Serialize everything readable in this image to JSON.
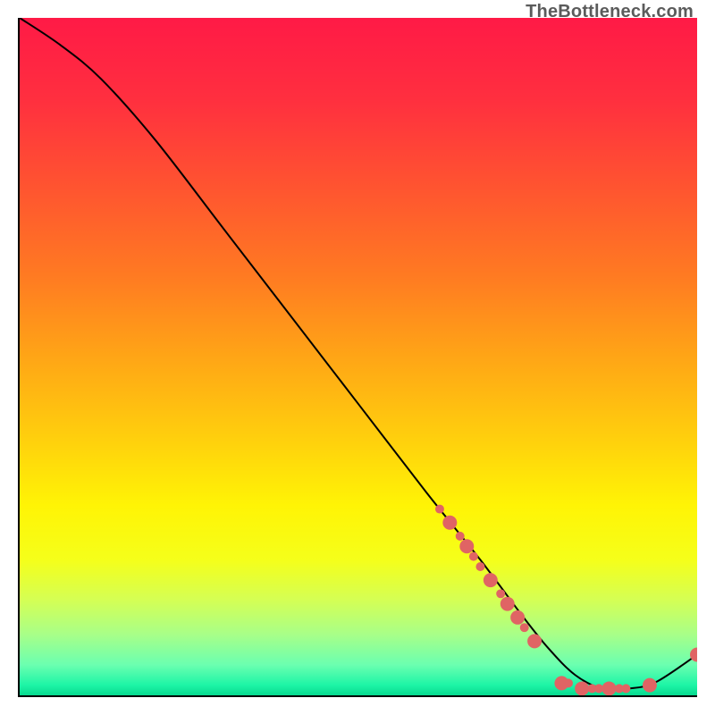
{
  "watermark": "TheBottleneck.com",
  "gradient_stops": [
    {
      "offset": 0.0,
      "color": "#ff1a46"
    },
    {
      "offset": 0.12,
      "color": "#ff2f3f"
    },
    {
      "offset": 0.25,
      "color": "#ff5430"
    },
    {
      "offset": 0.38,
      "color": "#ff7a22"
    },
    {
      "offset": 0.5,
      "color": "#ffa516"
    },
    {
      "offset": 0.62,
      "color": "#ffcf0d"
    },
    {
      "offset": 0.72,
      "color": "#fff405"
    },
    {
      "offset": 0.8,
      "color": "#f5ff1a"
    },
    {
      "offset": 0.86,
      "color": "#d4ff55"
    },
    {
      "offset": 0.91,
      "color": "#a8ff88"
    },
    {
      "offset": 0.955,
      "color": "#6bffb0"
    },
    {
      "offset": 0.985,
      "color": "#1df5a6"
    },
    {
      "offset": 1.0,
      "color": "#07d98f"
    }
  ],
  "chart_data": {
    "type": "line",
    "title": "",
    "xlabel": "",
    "ylabel": "",
    "xlim": [
      0,
      100
    ],
    "ylim": [
      0,
      100
    ],
    "series": [
      {
        "name": "bottleneck-curve",
        "x": [
          0,
          6,
          12,
          20,
          30,
          40,
          50,
          60,
          68,
          74,
          78,
          82,
          86,
          90,
          94,
          100
        ],
        "y": [
          100,
          96,
          91,
          82,
          69,
          56,
          43,
          30,
          20,
          12,
          7,
          3,
          1,
          1,
          2,
          6
        ]
      }
    ],
    "scatter": {
      "name": "sample-points",
      "color": "#e06464",
      "radius_small": 5,
      "radius_large": 8,
      "points": [
        {
          "x": 62.0,
          "y": 27.5,
          "r": "s"
        },
        {
          "x": 63.5,
          "y": 25.5,
          "r": "l"
        },
        {
          "x": 65.0,
          "y": 23.5,
          "r": "s"
        },
        {
          "x": 66.0,
          "y": 22.0,
          "r": "l"
        },
        {
          "x": 67.0,
          "y": 20.5,
          "r": "s"
        },
        {
          "x": 68.0,
          "y": 19.0,
          "r": "s"
        },
        {
          "x": 69.5,
          "y": 17.0,
          "r": "l"
        },
        {
          "x": 71.0,
          "y": 15.0,
          "r": "s"
        },
        {
          "x": 72.0,
          "y": 13.5,
          "r": "l"
        },
        {
          "x": 73.5,
          "y": 11.5,
          "r": "l"
        },
        {
          "x": 74.5,
          "y": 10.0,
          "r": "s"
        },
        {
          "x": 76.0,
          "y": 8.0,
          "r": "l"
        },
        {
          "x": 80.0,
          "y": 1.8,
          "r": "l"
        },
        {
          "x": 81.0,
          "y": 1.8,
          "r": "s"
        },
        {
          "x": 83.0,
          "y": 1.0,
          "r": "l"
        },
        {
          "x": 84.5,
          "y": 1.0,
          "r": "s"
        },
        {
          "x": 85.5,
          "y": 1.0,
          "r": "s"
        },
        {
          "x": 87.0,
          "y": 1.0,
          "r": "l"
        },
        {
          "x": 88.5,
          "y": 1.0,
          "r": "s"
        },
        {
          "x": 89.5,
          "y": 1.0,
          "r": "s"
        },
        {
          "x": 93.0,
          "y": 1.5,
          "r": "l"
        },
        {
          "x": 100.0,
          "y": 6.0,
          "r": "l"
        }
      ]
    }
  }
}
